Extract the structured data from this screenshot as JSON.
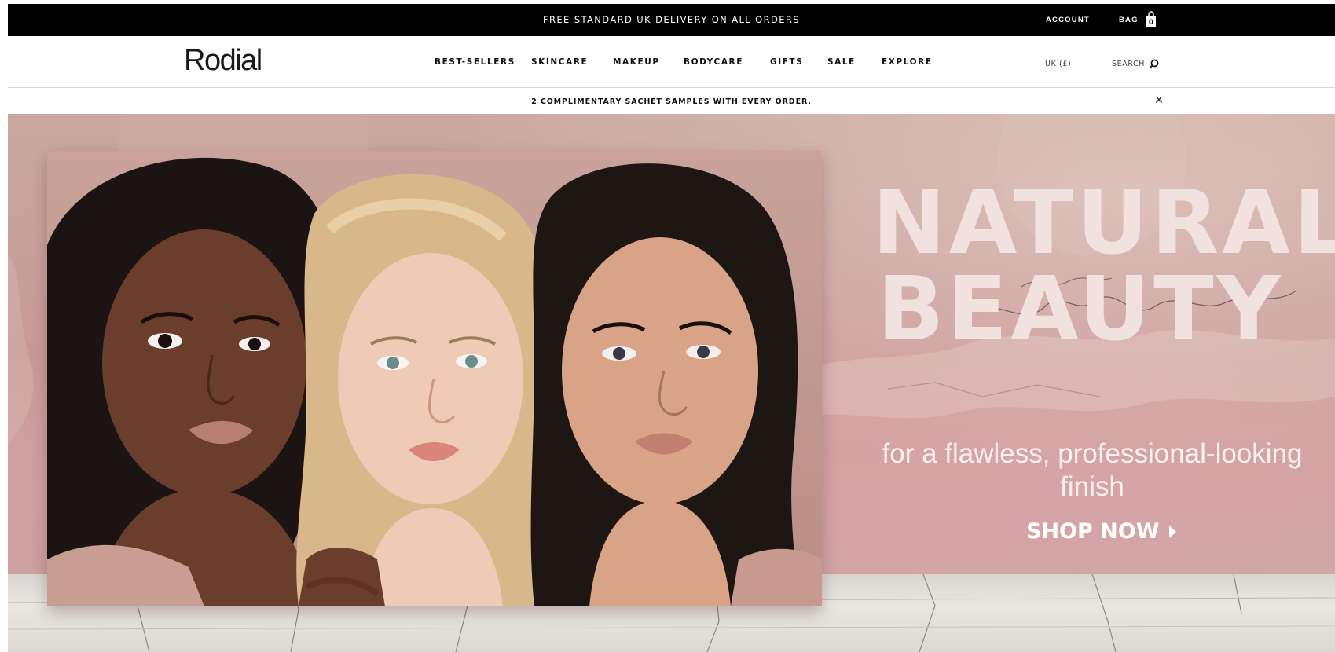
{
  "promo_bar": {
    "message": "FREE STANDARD UK DELIVERY ON ALL ORDERS",
    "account_label": "ACCOUNT",
    "bag_label": "BAG",
    "bag_count": "0"
  },
  "header": {
    "logo_text": "Rodial",
    "nav": [
      {
        "label": "BEST-SELLERS"
      },
      {
        "label": "SKINCARE"
      },
      {
        "label": "MAKEUP"
      },
      {
        "label": "BODYCARE"
      },
      {
        "label": "GIFTS"
      },
      {
        "label": "SALE"
      },
      {
        "label": "EXPLORE"
      }
    ],
    "locale_label": "UK (£)",
    "search_label": "SEARCH",
    "search_icon": "search-icon"
  },
  "samples_banner": {
    "message": "2 COMPLIMENTARY SACHET SAMPLES WITH EVERY ORDER.",
    "close_glyph": "×"
  },
  "hero": {
    "headline_line1": "NATURAL",
    "headline_line2": "BEAUTY",
    "subline": "for a flawless, professional-looking finish",
    "cta_label": "SHOP NOW",
    "cta_icon": "play-arrow-icon"
  },
  "colors": {
    "promo_bg": "#000000",
    "wall_pink": "#c9a39d",
    "headline_color": "#f1e2df"
  }
}
